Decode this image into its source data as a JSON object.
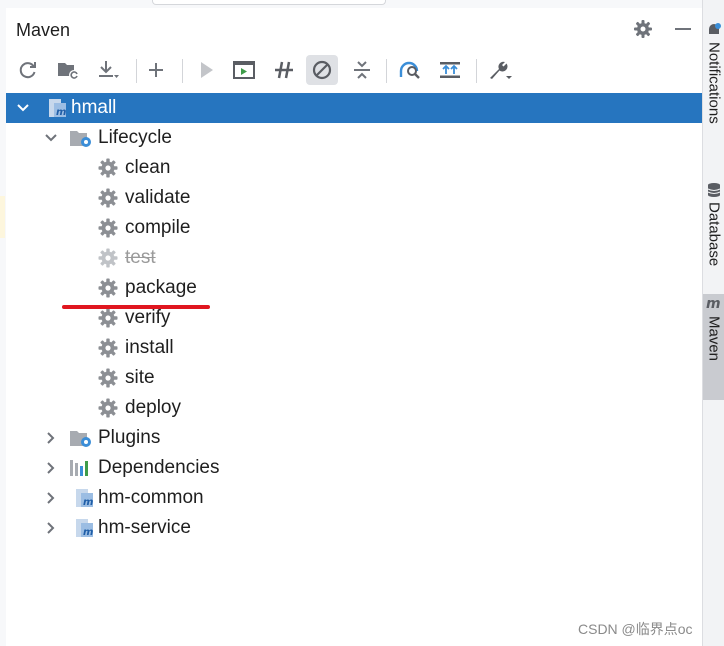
{
  "panel": {
    "title": "Maven",
    "settings_icon": "gear-icon",
    "hide_icon": "minus-icon"
  },
  "toolbar": {
    "buttons": [
      {
        "name": "reload-all-projects-button",
        "icon": "refresh-icon"
      },
      {
        "name": "generate-sources-button",
        "icon": "folder-refresh-icon"
      },
      {
        "name": "download-sources-button",
        "icon": "download-icon"
      },
      {
        "name": "add-maven-project-button",
        "icon": "plus-icon"
      },
      {
        "name": "run-maven-build-button",
        "icon": "play-icon"
      },
      {
        "name": "execute-maven-goal-button",
        "icon": "terminal-run-icon"
      },
      {
        "name": "toggle-offline-mode-button",
        "icon": "offline-icon"
      },
      {
        "name": "skip-tests-button",
        "icon": "skip-tests-icon",
        "active": true
      },
      {
        "name": "collapse-all-button",
        "icon": "collapse-icon"
      },
      {
        "name": "show-dependencies-button",
        "icon": "analyze-icon"
      },
      {
        "name": "show-diagram-button",
        "icon": "diagram-icon"
      },
      {
        "name": "build-tool-settings-button",
        "icon": "wrench-icon"
      }
    ]
  },
  "tree": {
    "root": {
      "label": "hmall",
      "expanded": true
    },
    "lifecycle": {
      "label": "Lifecycle",
      "expanded": true,
      "goals": [
        "clean",
        "validate",
        "compile",
        "test",
        "package",
        "verify",
        "install",
        "site",
        "deploy"
      ],
      "skipped_goal": "test"
    },
    "plugins": {
      "label": "Plugins"
    },
    "dependencies": {
      "label": "Dependencies"
    },
    "modules": [
      "hm-common",
      "hm-service"
    ]
  },
  "right_strip": {
    "tabs": [
      {
        "label": "Notifications",
        "icon": "bell-icon"
      },
      {
        "label": "Database",
        "icon": "database-icon"
      },
      {
        "label": "Maven",
        "icon": "maven-icon",
        "active": true
      }
    ]
  },
  "colors": {
    "selection": "#2675bf",
    "annotation_red": "#e0161f",
    "gear": "#8c8f94",
    "maven_blue": "#3b8ed8"
  },
  "watermark": "CSDN @临界点oc"
}
